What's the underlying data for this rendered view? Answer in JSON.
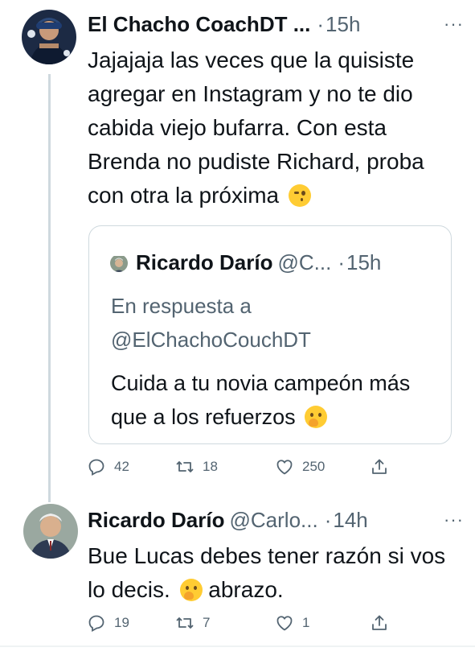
{
  "tweets": [
    {
      "author_name": "El Chacho CoachDT ...",
      "time_sep": "·",
      "time": "15h",
      "more": "···",
      "text": "Jajajaja las veces que la quisiste agregar en Instagram y no te dio cabida viejo bufarra. Con esta Brenda no pudiste Richard, proba con otra la próxima",
      "emoji": "winking-face",
      "quote": {
        "author_name": "Ricardo Darío",
        "handle": "@C...",
        "time_sep": "·",
        "time": "15h",
        "reply_line1": "En respuesta a",
        "reply_line2": "@ElChachoCouchDT",
        "text": "Cuida a tu novia campeón más que a los refuerzos",
        "emoji": "shushing-face"
      },
      "actions": {
        "reply": "42",
        "retweet": "18",
        "like": "250"
      }
    },
    {
      "author_name": "Ricardo Darío",
      "handle": "@Carlo...",
      "time_sep": "·",
      "time": "14h",
      "more": "···",
      "text_before": "Bue Lucas  debes tener razón si vos  lo decis.",
      "text_after": "abrazo.",
      "emoji": "shushing-face",
      "actions": {
        "reply": "19",
        "retweet": "7",
        "like": "1"
      }
    }
  ],
  "icons": {
    "reply": "reply-icon",
    "retweet": "retweet-icon",
    "like": "heart-icon",
    "share": "share-icon"
  },
  "colors": {
    "secondary_text": "#536471",
    "divider": "#cfd9de"
  }
}
